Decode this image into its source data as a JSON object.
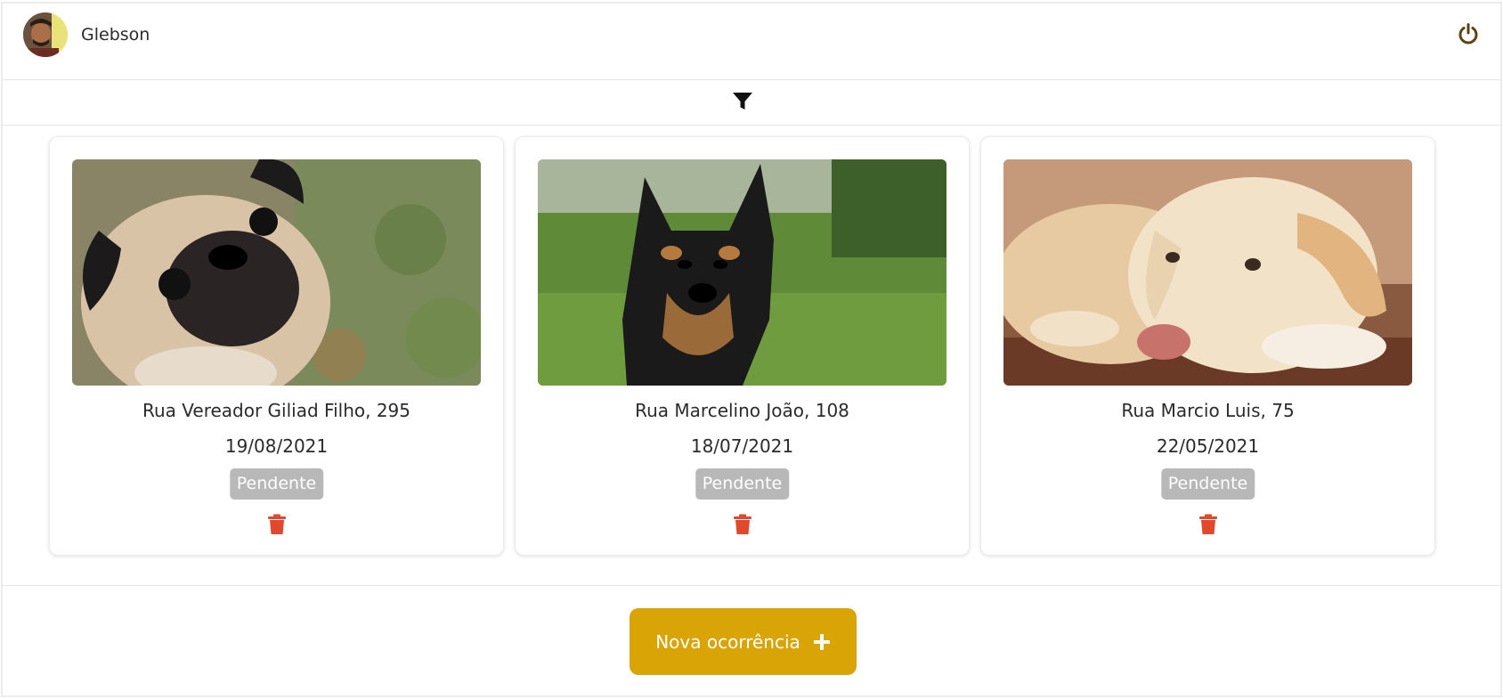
{
  "header": {
    "username": "Glebson",
    "avatar_icon": "user-avatar",
    "logout_icon": "power-icon"
  },
  "filter": {
    "icon": "filter-icon"
  },
  "occurrences": [
    {
      "address": "Rua Vereador Giliad Filho, 295",
      "date": "19/08/2021",
      "status": "Pendente",
      "photo": "pug-photo"
    },
    {
      "address": "Rua Marcelino João, 108",
      "date": "18/07/2021",
      "status": "Pendente",
      "photo": "pinscher-photo"
    },
    {
      "address": "Rua Marcio Luis, 75",
      "date": "22/05/2021",
      "status": "Pendente",
      "photo": "labrador-photo"
    }
  ],
  "footer": {
    "new_button_label": "Nova ocorrência"
  },
  "colors": {
    "accent": "#d9a405",
    "delete": "#e0492e",
    "status_bg": "#b8b8b8"
  }
}
